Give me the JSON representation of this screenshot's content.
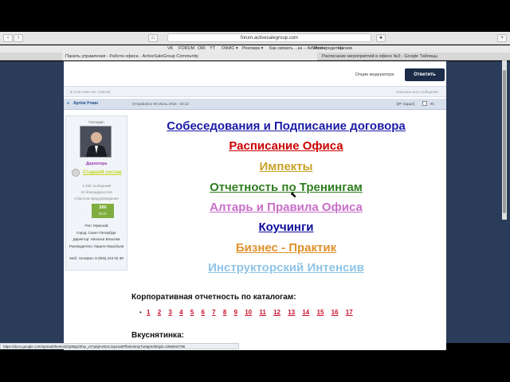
{
  "browser": {
    "address": "forum.activesalegroup.com",
    "bookmarks": [
      "VK",
      "FORUM",
      "ORI",
      "YT",
      "ОФИС ▾",
      "Реклама ▾",
      "Как связать ...ка – AdWords",
      "Мое-кредитор",
      "Нагиев"
    ],
    "tabs": [
      "Панель управления - Работа офиса - ActiveSaleGroup Community",
      "Расписание мероприятий в офисе №3 - Google Таблицы"
    ],
    "status_url": "https://docs.google.com/spreadsheets/d/1j9MpZ2hw_vs7p5jtAeEeL3opUa5Pfbstvint4yTuMg/edit#gid=1056944795"
  },
  "thread": {
    "moderator_options": "Опции модератора",
    "reply_button": "Ответить",
    "info_left": "В этой теме нет ответов",
    "info_right": "показаны все сообщения"
  },
  "post": {
    "author": "Артём Уткин",
    "sent": "Отправлено 08 Июнь 2016 - 20:12",
    "tags": "[IP: Скрыт]",
    "post_number": "#1",
    "sidebar": {
      "group_label": "Господин",
      "role": "Директора",
      "rank": "Старший состав",
      "messages": "3 436 сообщений",
      "thanks": "10 благодарностей",
      "warnings": "0 баллов предупреждения",
      "rep_value": "260",
      "rep_label": "Отлт",
      "gender": "Пол: Мужской",
      "city": "Город: Санкт-Петербург",
      "director": "Директор: Наталья Власова",
      "manager": "Руководитель: Кирилл Воробьев",
      "phone": "Моб. телефон: 8 (905) 223 02 38"
    }
  },
  "links": [
    {
      "label": "Собеседования и Подписание договора",
      "color": "#1a1aa6"
    },
    {
      "label": "Расписание Офиса",
      "color": "#cc0000"
    },
    {
      "label": "Импекты",
      "color": "#c9a227"
    },
    {
      "label": "Отчетность по Тренингам",
      "color": "#2e7d1f"
    },
    {
      "label": "Алтарь и Правила Офиса",
      "color": "#c86ec8"
    },
    {
      "label": "Коучинги",
      "color": "#0d0d9c"
    },
    {
      "label": "Бизнес - Практик",
      "color": "#e0912c"
    },
    {
      "label": "Инструкторский Интенсив",
      "color": "#8fc4e6"
    }
  ],
  "corporate": {
    "title": "Корпоративная отчетность по каталогам:",
    "numbers": [
      "1",
      "2",
      "3",
      "4",
      "5",
      "6",
      "7",
      "8",
      "9",
      "10",
      "11",
      "12",
      "13",
      "14",
      "15",
      "16",
      "17"
    ]
  },
  "tasty": "Вкуснятинка:"
}
